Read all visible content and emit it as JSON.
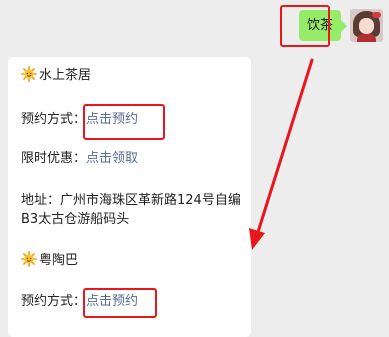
{
  "outgoing_message": {
    "text": "饮茶"
  },
  "reply": {
    "shops": [
      {
        "name": "水上茶居",
        "booking_label": "预约方式：",
        "booking_link": "点击预约",
        "discount_label": "限时优惠：",
        "discount_link": "点击领取",
        "address": "地址：广州市海珠区革新路124号自编B3太古仓游船码头"
      },
      {
        "name": "粤陶巴",
        "booking_label": "预约方式：",
        "booking_link": "点击预约"
      }
    ]
  },
  "colors": {
    "bubble_green": "#95ec69",
    "link": "#576b95",
    "highlight": "#e8171c"
  },
  "icons": {
    "shop_marker": "sun-emoji-icon",
    "avatar": "user-avatar"
  }
}
